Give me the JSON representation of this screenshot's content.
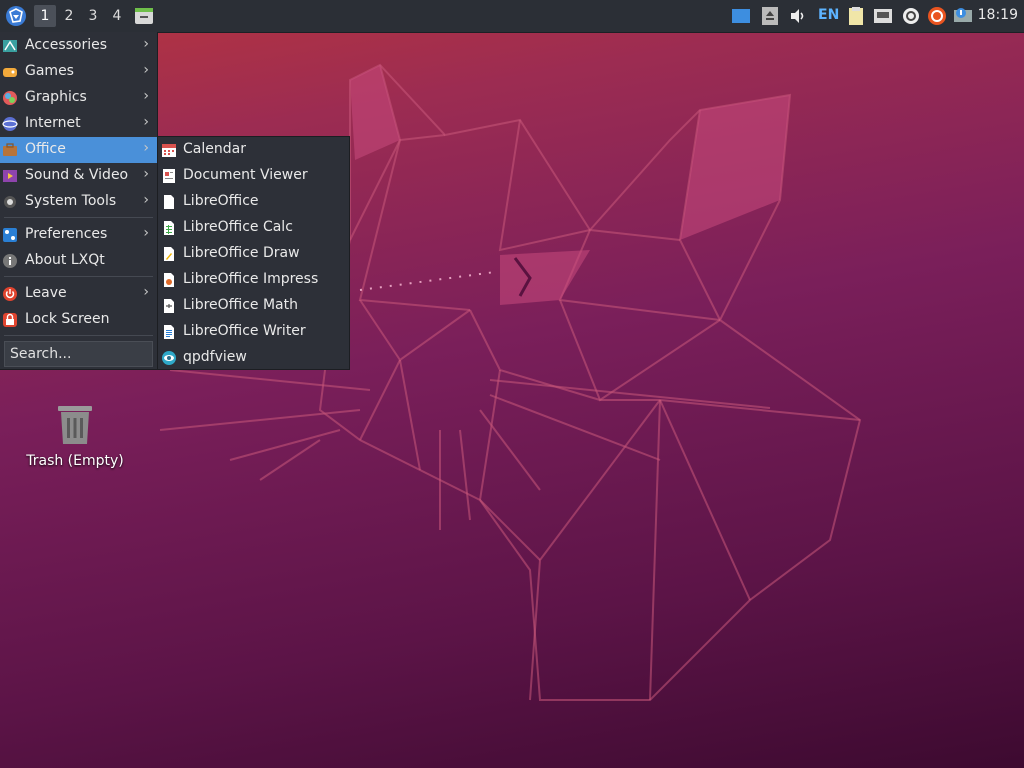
{
  "panel": {
    "workspaces": [
      "1",
      "2",
      "3",
      "4"
    ],
    "active_workspace": "1",
    "keyboard_layout": "EN",
    "clock": "18:19"
  },
  "menu": {
    "items": [
      {
        "label": "Accessories",
        "icon": "accessories-icon",
        "submenu": true
      },
      {
        "label": "Games",
        "icon": "games-icon",
        "submenu": true
      },
      {
        "label": "Graphics",
        "icon": "graphics-icon",
        "submenu": true
      },
      {
        "label": "Internet",
        "icon": "internet-icon",
        "submenu": true
      },
      {
        "label": "Office",
        "icon": "office-icon",
        "submenu": true,
        "active": true
      },
      {
        "label": "Sound & Video",
        "icon": "sound-video-icon",
        "submenu": true
      },
      {
        "label": "System Tools",
        "icon": "system-tools-icon",
        "submenu": true
      },
      {
        "label": "Preferences",
        "icon": "preferences-icon",
        "submenu": true
      },
      {
        "label": "About LXQt",
        "icon": "info-icon",
        "submenu": false
      },
      {
        "label": "Leave",
        "icon": "power-icon",
        "submenu": true
      },
      {
        "label": "Lock Screen",
        "icon": "lock-icon",
        "submenu": false
      }
    ],
    "arrow": "›",
    "search_placeholder": "Search..."
  },
  "office_submenu": {
    "items": [
      {
        "label": "Calendar",
        "icon": "calendar-icon"
      },
      {
        "label": "Document Viewer",
        "icon": "document-viewer-icon"
      },
      {
        "label": "LibreOffice",
        "icon": "libreoffice-icon"
      },
      {
        "label": "LibreOffice Calc",
        "icon": "calc-icon"
      },
      {
        "label": "LibreOffice Draw",
        "icon": "draw-icon"
      },
      {
        "label": "LibreOffice Impress",
        "icon": "impress-icon"
      },
      {
        "label": "LibreOffice Math",
        "icon": "math-icon"
      },
      {
        "label": "LibreOffice Writer",
        "icon": "writer-icon"
      },
      {
        "label": "qpdfview",
        "icon": "qpdfview-icon"
      }
    ]
  },
  "desktop": {
    "trash_label": "Trash (Empty)"
  },
  "colors": {
    "menu_bg": "#2d3038",
    "highlight": "#4a90d9",
    "panel_bg": "#2b2f36"
  }
}
